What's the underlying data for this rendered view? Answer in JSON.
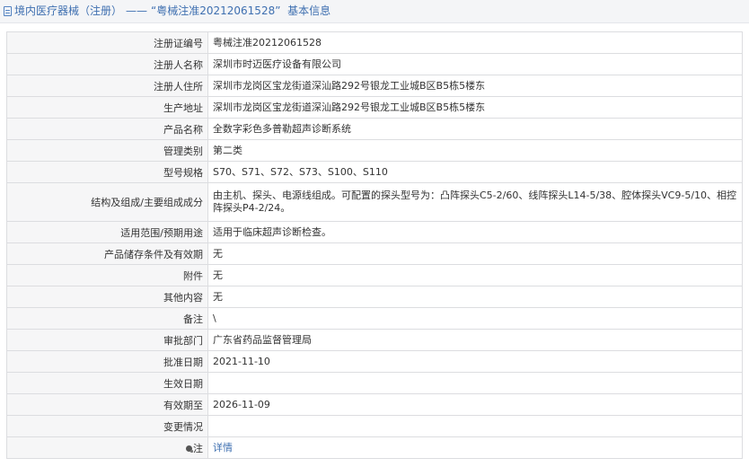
{
  "header": {
    "breadcrumb_root": "境内医疗器械（注册）",
    "separator": "——",
    "record_title": "“粤械注准20212061528”",
    "section": "基本信息"
  },
  "rows": [
    {
      "label": "注册证编号",
      "value": "粤械注准20212061528"
    },
    {
      "label": "注册人名称",
      "value": "深圳市时迈医疗设备有限公司"
    },
    {
      "label": "注册人住所",
      "value": "深圳市龙岗区宝龙街道深汕路292号银龙工业城B区B5栋5楼东"
    },
    {
      "label": "生产地址",
      "value": "深圳市龙岗区宝龙街道深汕路292号银龙工业城B区B5栋5楼东"
    },
    {
      "label": "产品名称",
      "value": "全数字彩色多普勒超声诊断系统"
    },
    {
      "label": "管理类别",
      "value": "第二类"
    },
    {
      "label": "型号规格",
      "value": "S70、S71、S72、S73、S100、S110"
    },
    {
      "label": "结构及组成/主要组成成分",
      "value": "由主机、探头、电源线组成。可配置的探头型号为：凸阵探头C5-2/60、线阵探头L14-5/38、腔体探头VC9-5/10、相控阵探头P4-2/24。"
    },
    {
      "label": "适用范围/预期用途",
      "value": "适用于临床超声诊断检查。"
    },
    {
      "label": "产品储存条件及有效期",
      "value": "无"
    },
    {
      "label": "附件",
      "value": "无"
    },
    {
      "label": "其他内容",
      "value": "无"
    },
    {
      "label": "备注",
      "value": "\\"
    },
    {
      "label": "审批部门",
      "value": "广东省药品监督管理局"
    },
    {
      "label": "批准日期",
      "value": "2021-11-10"
    },
    {
      "label": "生效日期",
      "value": ""
    },
    {
      "label": "有效期至",
      "value": "2026-11-09"
    },
    {
      "label": "变更情况",
      "value": ""
    },
    {
      "label": "注",
      "value": "详情"
    }
  ]
}
